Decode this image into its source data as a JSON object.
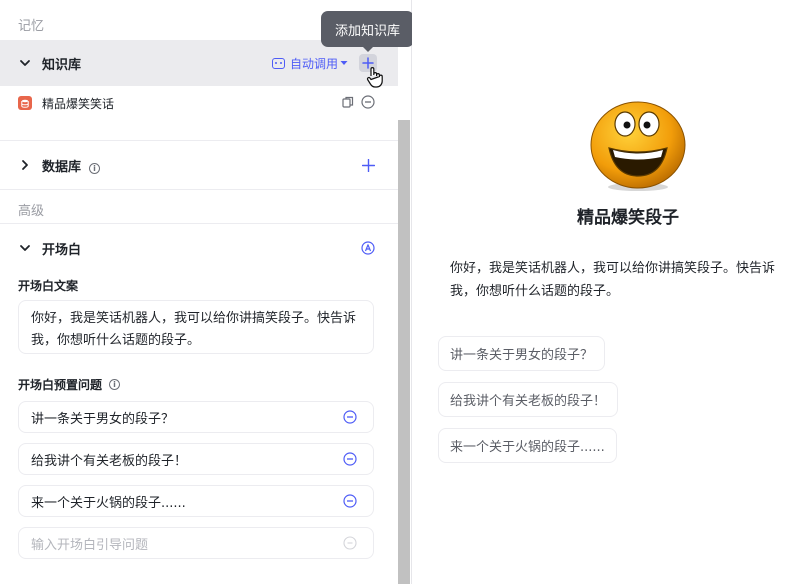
{
  "memory": {
    "section_label": "记忆",
    "knowledge": {
      "title": "知识库",
      "auto_label": "自动调用",
      "tooltip": "添加知识库",
      "items": [
        {
          "name": "精品爆笑笑话"
        }
      ]
    },
    "database": {
      "title": "数据库"
    }
  },
  "advanced": {
    "section_label": "高级",
    "opening": {
      "title": "开场白",
      "text_label": "开场白文案",
      "text_value": "你好，我是笑话机器人，我可以给你讲搞笑段子。快告诉我，你想听什么话题的段子。",
      "questions_label": "开场白预置问题",
      "questions": [
        "讲一条关于男女的段子？",
        "给我讲个有关老板的段子！",
        "来一个关于火锅的段子......"
      ],
      "question_placeholder": "输入开场白引导问题"
    }
  },
  "preview": {
    "bot_name": "精品爆笑段子",
    "greeting_line1": "你好，我是笑话机器人，我可以给你讲搞笑段子。快告诉",
    "greeting_line2": "我，你想听什么话题的段子。",
    "suggestions": [
      "讲一条关于男女的段子？",
      "给我讲个有关老板的段子！",
      "来一个关于火锅的段子......"
    ]
  },
  "colors": {
    "accent": "#4e5cf6",
    "database_icon": "#e8664b"
  }
}
